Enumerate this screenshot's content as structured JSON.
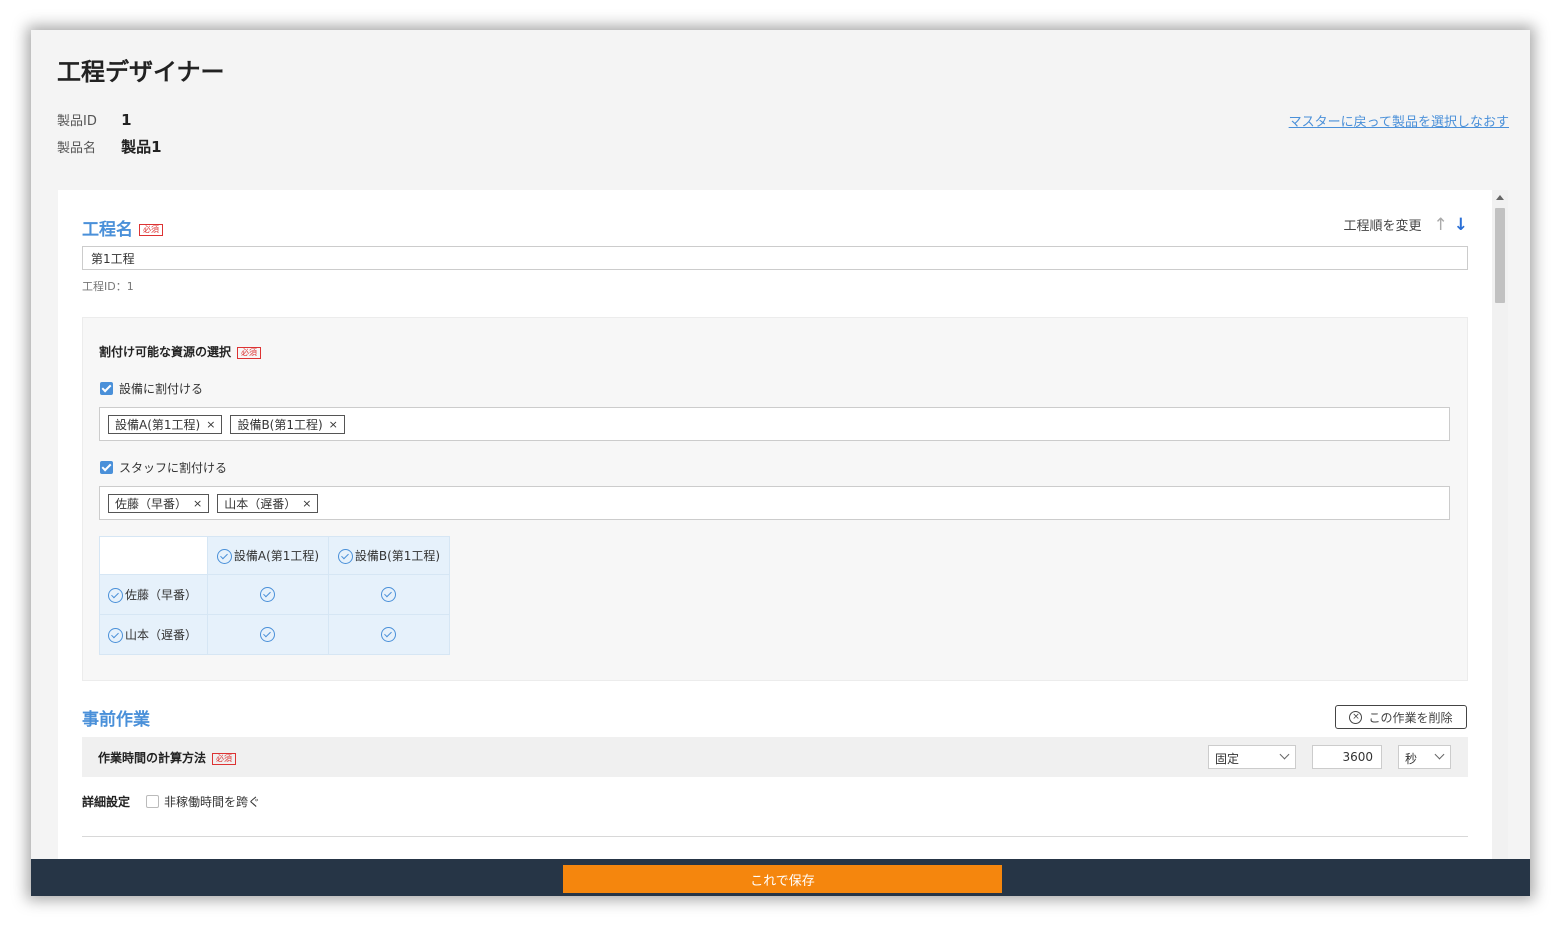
{
  "app": {
    "title": "工程デザイナー",
    "back_link": "マスターに戻って製品を選択しなおす"
  },
  "product": {
    "id_label": "製品ID",
    "id_value": "1",
    "name_label": "製品名",
    "name_value": "製品1"
  },
  "process": {
    "section_title": "工程名",
    "required_badge": "必須",
    "order_label": "工程順を変更",
    "order_up_icon": "↑",
    "order_down_icon": "↓",
    "name_value": "第1工程",
    "id_text": "工程ID：1"
  },
  "resources": {
    "title": "割付け可能な資源の選択",
    "equipment_checkbox_label": "設備に割付ける",
    "equipment_checked": true,
    "equipment_tags": [
      "設備A(第1工程)",
      "設備B(第1工程)"
    ],
    "staff_checkbox_label": "スタッフに割付ける",
    "staff_checked": true,
    "staff_tags": [
      "佐藤（早番）",
      "山本（遅番）"
    ],
    "tag_remove_icon": "×",
    "matrix": {
      "columns": [
        "設備A(第1工程)",
        "設備B(第1工程)"
      ],
      "rows": [
        "佐藤（早番）",
        "山本（遅番）"
      ]
    }
  },
  "pre_work": {
    "section_title": "事前作業",
    "delete_button": "この作業を削除",
    "calc_label": "作業時間の計算方法",
    "method_value": "固定",
    "time_value": "3600",
    "unit_value": "秒",
    "detail_label": "詳細設定",
    "span_label": "非稼働時間を跨ぐ",
    "span_checked": false
  },
  "footer": {
    "save_button": "これで保存"
  },
  "colors": {
    "accent": "#4a90d9",
    "save": "#f5860d",
    "footer": "#263546",
    "required": "#dd3333"
  }
}
